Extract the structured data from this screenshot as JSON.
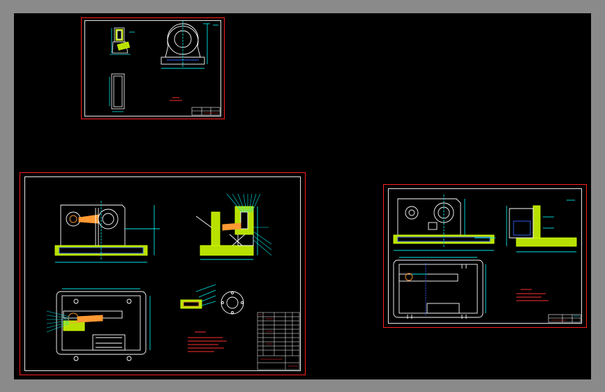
{
  "viewport": {
    "background": "#000000",
    "frame_color": "#8a8a8a"
  },
  "colors": {
    "sheet_border": "#ff2020",
    "inner_border": "#e8e8e8",
    "outline": "#ffffff",
    "dimension": "#00e5e5",
    "section_fill": "#b8e000",
    "hatch": "#d4ff00",
    "annotation": "#ff3030",
    "hidden_lines": "#3366ff",
    "parts": "#ff9933"
  },
  "sheets": [
    {
      "name": "part-drawing-sheet",
      "views": [
        "front-view",
        "side-view",
        "top-view"
      ]
    },
    {
      "name": "assembly-drawing-sheet",
      "views": [
        "front-view",
        "side-view",
        "plan-view",
        "detail-view"
      ]
    },
    {
      "name": "fixture-body-sheet",
      "views": [
        "front-view",
        "side-view",
        "plan-view"
      ]
    }
  ]
}
